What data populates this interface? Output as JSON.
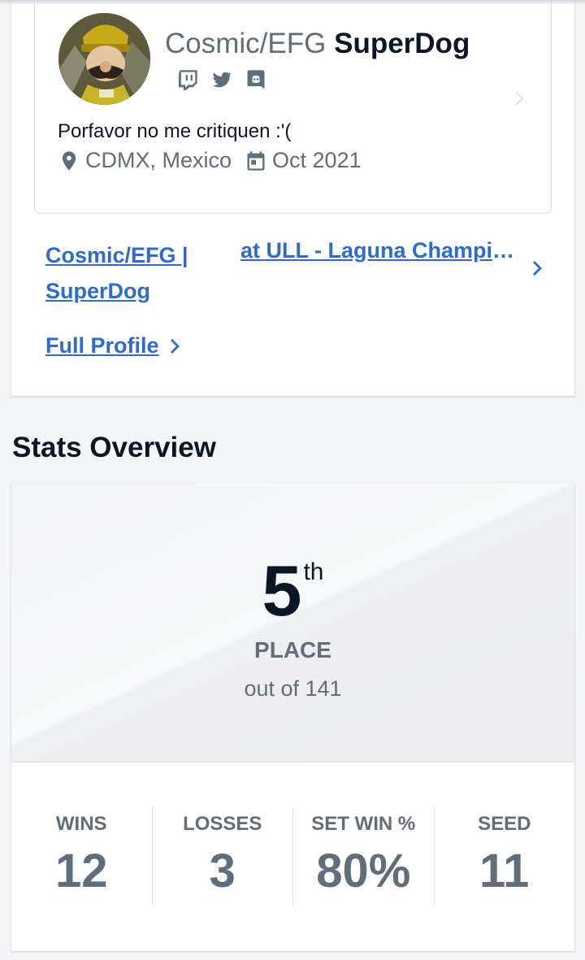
{
  "profile": {
    "name_prefix": "Cosmic/EFG",
    "gamer_tag": "SuperDog",
    "bio": "Porfavor no me critiquen :'(",
    "location": "CDMX, Mexico",
    "joined": "Oct 2021",
    "social_icons": [
      "twitch-icon",
      "twitter-icon",
      "discord-icon"
    ]
  },
  "entrant": {
    "player_link": "Cosmic/EFG | SuperDog",
    "at_prefix": "at",
    "tournament_link": "ULL - Laguna Championship"
  },
  "full_profile_label": "Full Profile",
  "stats_section_title": "Stats Overview",
  "placement": {
    "place": "5",
    "ordinal": "th",
    "label": "PLACE",
    "out_of": "out of 141"
  },
  "stats": [
    {
      "label": "WINS",
      "value": "12"
    },
    {
      "label": "LOSSES",
      "value": "3"
    },
    {
      "label": "SET WIN %",
      "value": "80%"
    },
    {
      "label": "SEED",
      "value": "11"
    }
  ],
  "colors": {
    "link": "#2e6bcb",
    "text_dark": "#0b1626",
    "text_muted": "#606d7a"
  }
}
